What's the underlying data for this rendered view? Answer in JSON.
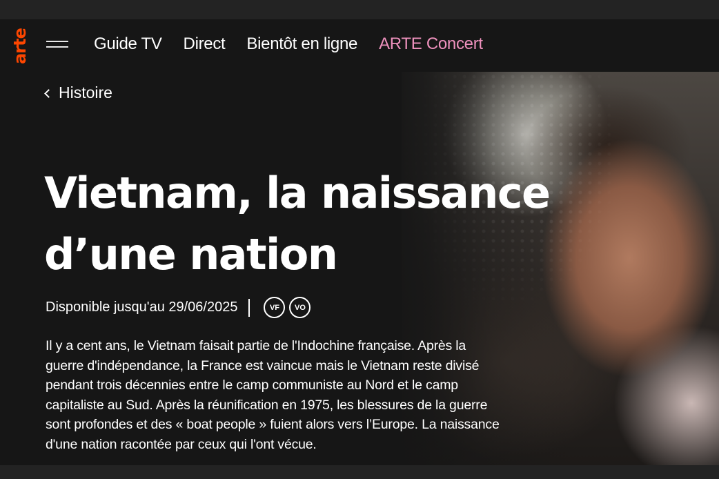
{
  "header": {
    "logo_text": "arte",
    "nav": [
      {
        "label": "Guide TV"
      },
      {
        "label": "Direct"
      },
      {
        "label": "Bientôt en ligne"
      },
      {
        "label": "ARTE Concert",
        "color": "#ee91bd"
      }
    ]
  },
  "breadcrumb": {
    "label": "Histoire"
  },
  "program": {
    "title_lines": [
      "Vietnam, la naissance",
      "d’une nation"
    ],
    "availability": "Disponible jusqu'au 29/06/2025",
    "badges": [
      "VF",
      "VO"
    ],
    "description_lines": [
      "Il y a cent ans, le Vietnam faisait partie de l'Indochine française. Après la",
      "guerre d'indépendance, la France est vaincue mais le Vietnam reste divisé",
      "pendant trois décennies entre le camp communiste au Nord et le camp",
      "capitaliste au Sud. Après la réunification en 1975, les blessures de la guerre",
      "sont profondes et des « boat people » fuient alors vers l’Europe. La naissance",
      "d'une nation racontée par ceux qui l'ont vécue."
    ]
  },
  "colors": {
    "background": "#161616",
    "logo": "#fd4600",
    "accent_link": "#ee91bd"
  },
  "icons": {
    "menu": "hamburger-menu-icon",
    "back": "chevron-left-icon"
  }
}
